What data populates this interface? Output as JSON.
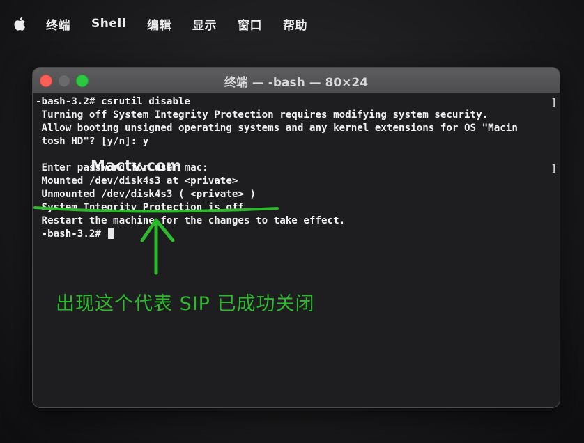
{
  "menubar": {
    "apple_icon": "apple-icon",
    "items": [
      "终端",
      "Shell",
      "编辑",
      "显示",
      "窗口",
      "帮助"
    ]
  },
  "window": {
    "title": "终端 — -bash — 80×24",
    "buttons": [
      "close",
      "minimize",
      "maximize"
    ]
  },
  "terminal": {
    "lines": [
      "-bash-3.2# csrutil disable",
      " Turning off System Integrity Protection requires modifying system security.",
      " Allow booting unsigned operating systems and any kernel extensions for OS \"Macin",
      " tosh HD\"? [y/n]: y",
      "",
      " Enter password for user mac:",
      " Mounted /dev/disk4s3 at <private>",
      " Unmounted /dev/disk4s3 ( <private> )",
      " System Integrity Protection is off.",
      " Restart the machine for the changes to take effect.",
      " -bash-3.2# "
    ],
    "bracket": "]"
  },
  "annotation": {
    "watermark": "Mactv.com",
    "caption": "出现这个代表 SIP 已成功关闭",
    "color": "#2eb82e"
  }
}
